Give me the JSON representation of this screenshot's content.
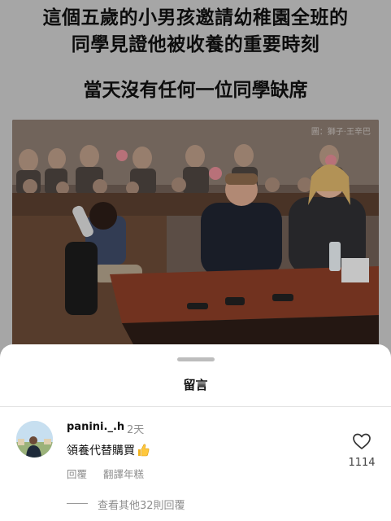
{
  "post": {
    "headline_line1": "這個五歲的小男孩邀請幼稚園全班的",
    "headline_line2": "同學見證他被收養的重要時刻",
    "headline_line3": "當天沒有任何一位同學缺席",
    "photo_watermark": "圖：獅子·王辛巴"
  },
  "sheet": {
    "title": "留言"
  },
  "comment": {
    "username": "panini._.h",
    "time": "2天",
    "text": "領養代替購買",
    "reply_label": "回覆",
    "translate_label": "翻譯年糕",
    "like_count": "1114",
    "icons": {
      "like": "heart-outline-icon",
      "emoji": "thumbs-up-icon"
    }
  },
  "more_replies": {
    "label": "查看其他32則回覆"
  }
}
